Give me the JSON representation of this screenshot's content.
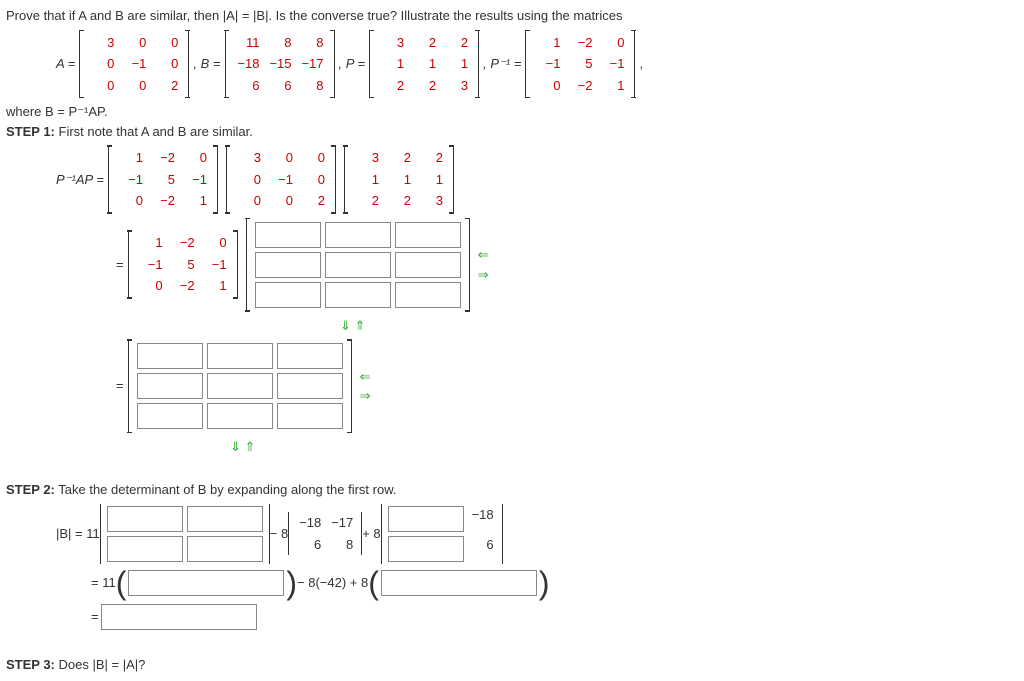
{
  "intro": "Prove that if A and B are similar, then |A| = |B|. Is the converse true? Illustrate the results using the matrices",
  "A": [
    [
      "3",
      "0",
      "0"
    ],
    [
      "0",
      "−1",
      "0"
    ],
    [
      "0",
      "0",
      "2"
    ]
  ],
  "B": [
    [
      "11",
      "8",
      "8"
    ],
    [
      "−18",
      "−15",
      "−17"
    ],
    [
      "6",
      "6",
      "8"
    ]
  ],
  "P": [
    [
      "3",
      "2",
      "2"
    ],
    [
      "1",
      "1",
      "1"
    ],
    [
      "2",
      "2",
      "3"
    ]
  ],
  "Pi": [
    [
      "1",
      "−2",
      "0"
    ],
    [
      "−1",
      "5",
      "−1"
    ],
    [
      "0",
      "−2",
      "1"
    ]
  ],
  "where": "where B = P⁻¹AP.",
  "s1": "STEP 1:",
  "s1t": " First note that A and B are similar.",
  "s2": "STEP 2:",
  "s2t": " Take the determinant of B by expanding along the first row.",
  "s3": "STEP 3:",
  "s3t": " Does |B| = |A|?",
  "eq": {
    "Aeq": "A = ",
    "Beq": ", B = ",
    "Peq": ", P = ",
    "Pieq": ", P⁻¹ = ",
    "com": ","
  },
  "pap": "P⁻¹AP = ",
  "eqsym": "= ",
  "detB": "|B| = 11",
  "m8": " − 8",
  "p8": " + 8",
  "minor": [
    [
      "−18",
      "−17"
    ],
    [
      "6",
      "8"
    ]
  ],
  "m18": "−18",
  "six": "6",
  "l2a": "= 11",
  "l2b": " − 8(−42) + 8"
}
